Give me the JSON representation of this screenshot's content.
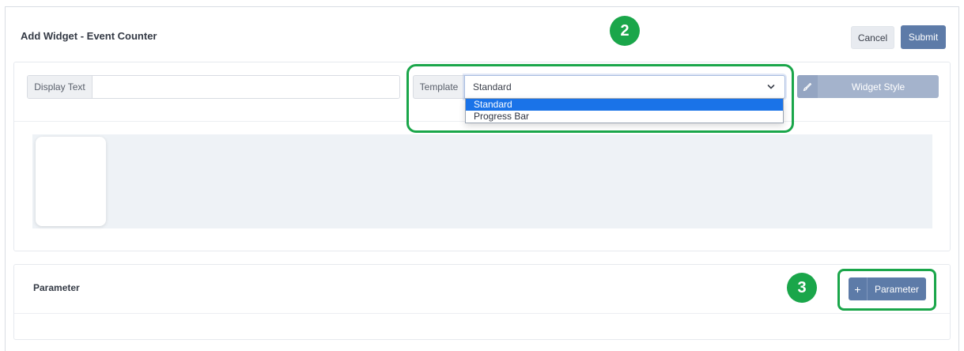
{
  "header": {
    "title": "Add Widget - Event Counter",
    "cancel_label": "Cancel",
    "submit_label": "Submit"
  },
  "form": {
    "display_text_label": "Display Text",
    "display_text_value": "",
    "template_label": "Template",
    "template_value": "Standard",
    "template_options": [
      "Standard",
      "Progress Bar"
    ],
    "widget_style_label": "Widget Style"
  },
  "parameter": {
    "title": "Parameter",
    "add_button_label": "Parameter",
    "add_button_icon": "+"
  },
  "annotations": {
    "badge_2": "2",
    "badge_3": "3",
    "highlight_color": "#1aa64a"
  },
  "icons": {
    "chevron": "chevron-down-icon",
    "widget_style": "brush-icon",
    "plus": "plus-icon"
  },
  "colors": {
    "primary": "#5d7ba8",
    "selected_option": "#1a73e8",
    "widget_style_btn": "#a4b3cc"
  }
}
